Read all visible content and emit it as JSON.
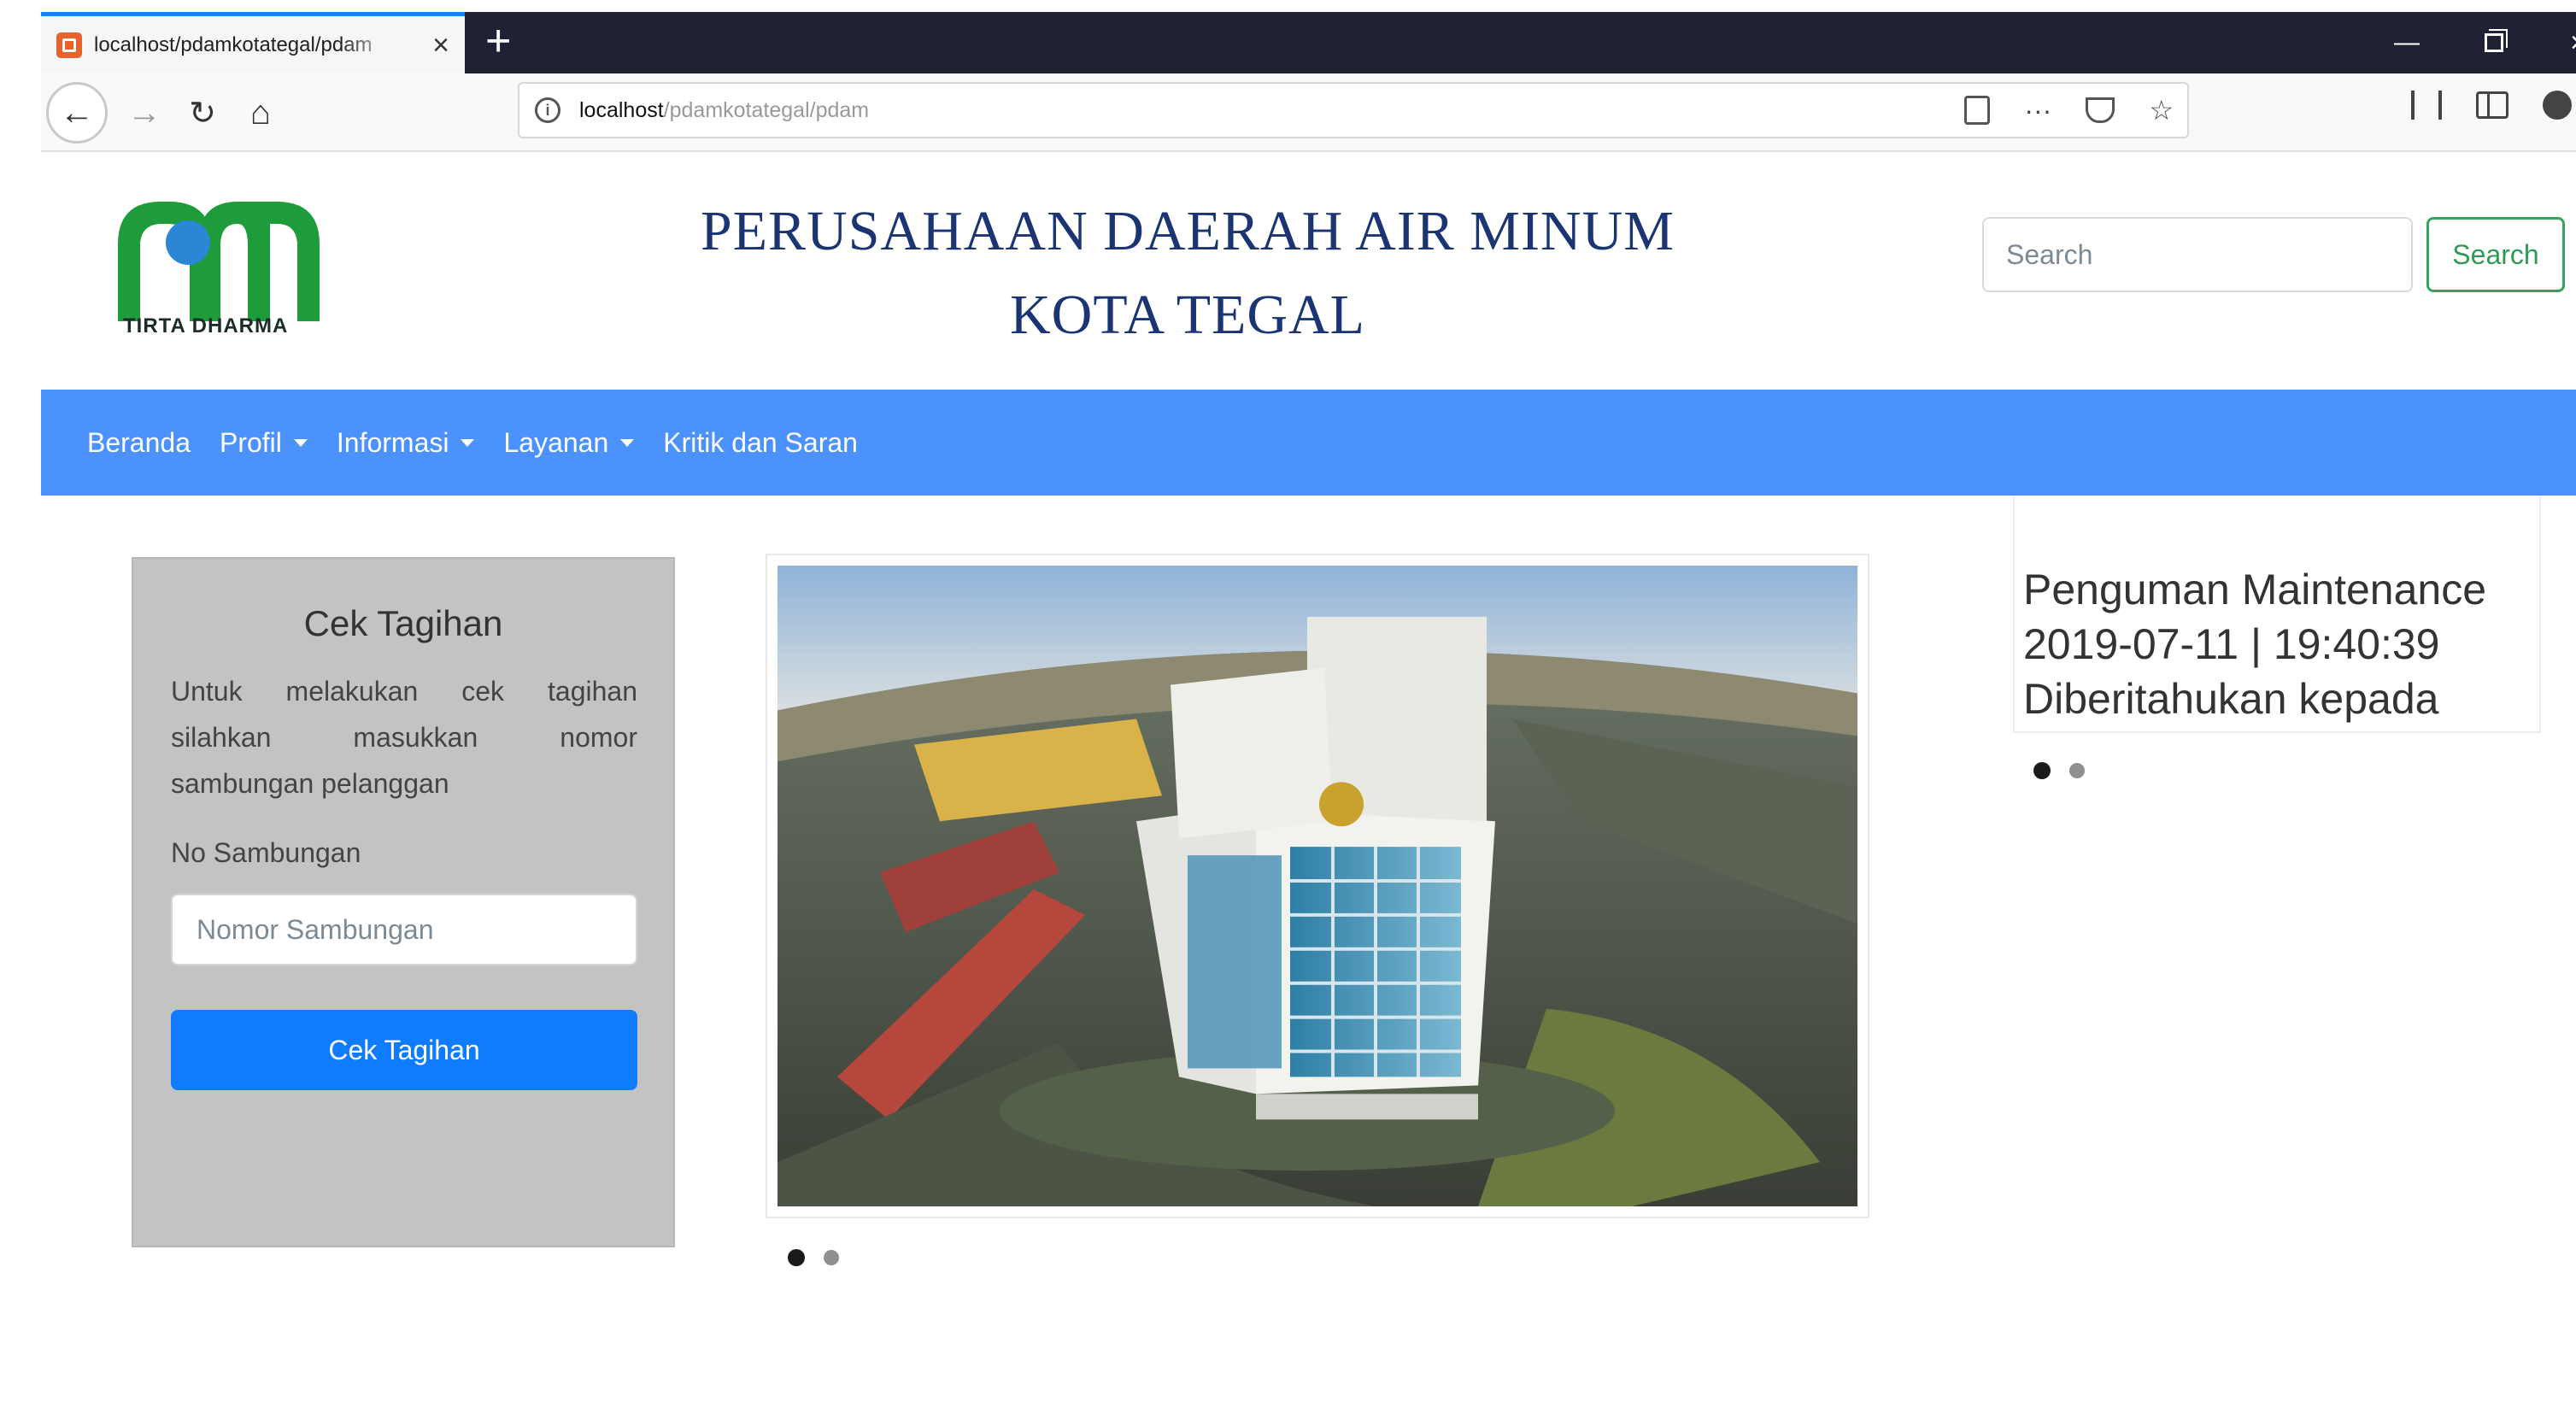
{
  "browser": {
    "tab_title": "localhost/pdamkotategal/pdam",
    "url_host": "localhost",
    "url_path": "/pdamkotategal/pdam",
    "more_label": "···"
  },
  "header": {
    "logo_caption": "TIRTA DHARMA",
    "title_line1": "PERUSAHAAN DAERAH AIR MINUM",
    "title_line2": "KOTA TEGAL",
    "search_placeholder": "Search",
    "search_button": "Search"
  },
  "nav": {
    "items": [
      {
        "label": "Beranda",
        "dropdown": false
      },
      {
        "label": "Profil",
        "dropdown": true
      },
      {
        "label": "Informasi",
        "dropdown": true
      },
      {
        "label": "Layanan",
        "dropdown": true
      },
      {
        "label": "Kritik dan Saran",
        "dropdown": false
      }
    ]
  },
  "cek_tagihan": {
    "title": "Cek Tagihan",
    "description": "Untuk melakukan cek tagihan silahkan masukkan nomor sambungan pelanggan",
    "field_label": "No Sambungan",
    "field_placeholder": "Nomor Sambungan",
    "button_label": "Cek Tagihan"
  },
  "announcement": {
    "title": "Penguman Maintenance",
    "datetime": "2019-07-11 | 19:40:39",
    "text": "Diberitahukan kepada"
  },
  "colors": {
    "nav_bg": "#4b92ff",
    "primary_button": "#0f7bff",
    "search_button_border": "#35a35e",
    "title_color": "#1a3474",
    "card_bg": "#c3c3c3"
  }
}
